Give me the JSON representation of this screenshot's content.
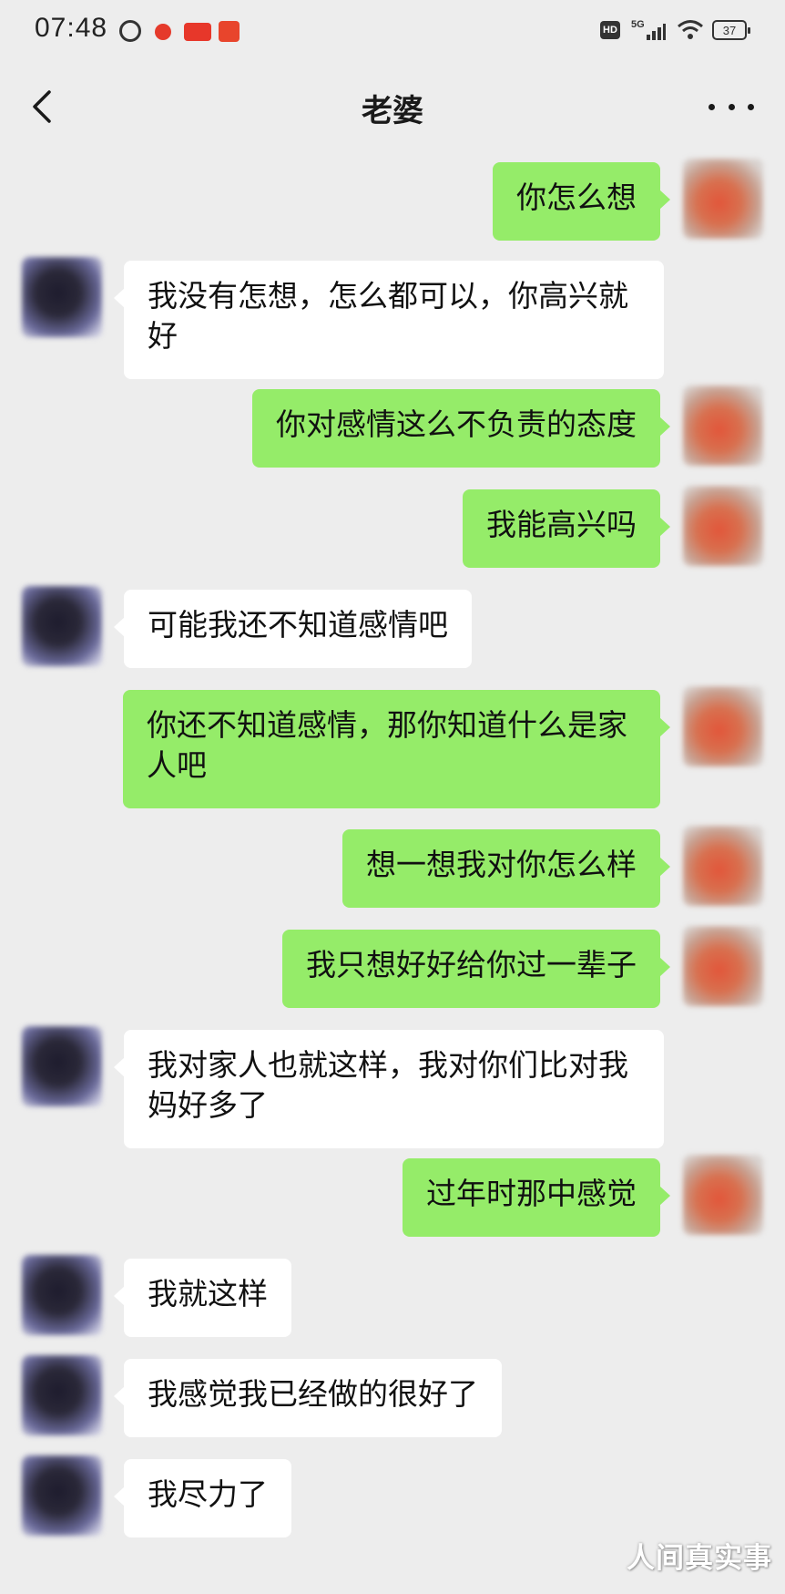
{
  "status_bar": {
    "time": "07:48",
    "hd_label": "HD",
    "network": "5G",
    "battery": "37"
  },
  "header": {
    "title": "老婆"
  },
  "messages": [
    {
      "side": "right",
      "text": "你怎么想"
    },
    {
      "side": "left",
      "text": "我没有怎想，怎么都可以，你高兴就好"
    },
    {
      "side": "right",
      "text": "你对感情这么不负责的态度"
    },
    {
      "side": "right",
      "text": "我能高兴吗"
    },
    {
      "side": "left",
      "text": "可能我还不知道感情吧"
    },
    {
      "side": "right",
      "text": "你还不知道感情，那你知道什么是家人吧"
    },
    {
      "side": "right",
      "text": "想一想我对你怎么样"
    },
    {
      "side": "right",
      "text": "我只想好好给你过一辈子"
    },
    {
      "side": "left",
      "text": "我对家人也就这样，我对你们比对我妈好多了"
    },
    {
      "side": "right",
      "text": "过年时那中感觉"
    },
    {
      "side": "left",
      "text": "我就这样"
    },
    {
      "side": "left",
      "text": "我感觉我已经做的很好了"
    },
    {
      "side": "left",
      "text": "我尽力了"
    }
  ],
  "watermark": "人间真实事",
  "colors": {
    "background": "#ededed",
    "outgoing_bubble": "#95ec69",
    "incoming_bubble": "#ffffff"
  }
}
